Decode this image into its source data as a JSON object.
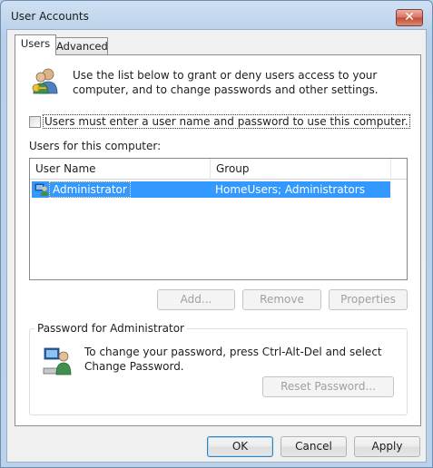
{
  "window": {
    "title": "User Accounts",
    "close_glyph": "✕"
  },
  "tabs": [
    {
      "label": "Users",
      "selected": true
    },
    {
      "label": "Advanced",
      "selected": false
    }
  ],
  "intro": {
    "icon": "users-keys-icon",
    "text": "Use the list below to grant or deny users access to your computer, and to change passwords and other settings."
  },
  "require_login": {
    "label": "Users must enter a user name and password to use this computer.",
    "checked": false
  },
  "users_list": {
    "label": "Users for this computer:",
    "columns": [
      "User Name",
      "Group"
    ],
    "rows": [
      {
        "icon": "user-icon",
        "user_name": "Administrator",
        "group": "HomeUsers; Administrators",
        "selected": true
      }
    ]
  },
  "list_buttons": {
    "add": "Add...",
    "remove": "Remove",
    "properties": "Properties"
  },
  "password_group": {
    "title": "Password for Administrator",
    "icon": "user-keyboard-icon",
    "text": "To change your password, press Ctrl-Alt-Del and select Change Password.",
    "reset_button": "Reset Password..."
  },
  "dialog_buttons": {
    "ok": "OK",
    "cancel": "Cancel",
    "apply": "Apply"
  },
  "colors": {
    "selection": "#3399ff",
    "tab_page": "#ffffff",
    "dialog_bg": "#f0f0f0"
  }
}
